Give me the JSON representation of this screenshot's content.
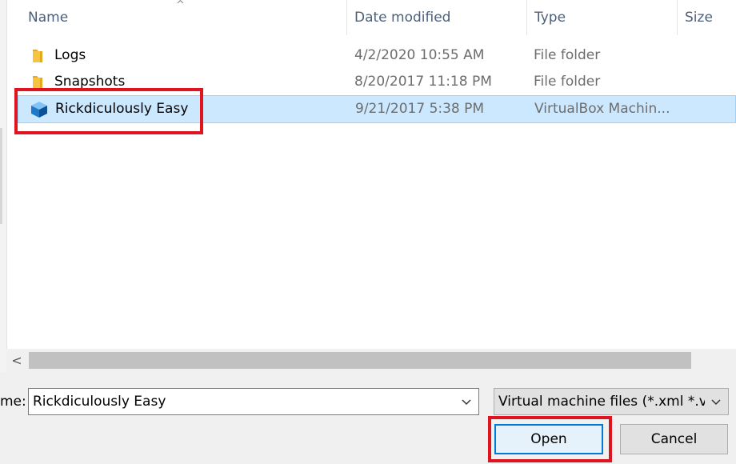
{
  "columns": {
    "name": "Name",
    "date": "Date modified",
    "type": "Type",
    "size": "Size"
  },
  "files": [
    {
      "icon": "folder-icon",
      "name": "Logs",
      "date": "4/2/2020 10:55 AM",
      "type": "File folder",
      "selected": false
    },
    {
      "icon": "folder-icon",
      "name": "Snapshots",
      "date": "8/20/2017 11:18 PM",
      "type": "File folder",
      "selected": false
    },
    {
      "icon": "virtualbox-machine-icon",
      "name": "Rickdiculously Easy",
      "date": "9/21/2017 5:38 PM",
      "type": "VirtualBox Machin...",
      "selected": true
    }
  ],
  "filename": {
    "label": "me:",
    "value": "Rickdiculously Easy"
  },
  "filter": {
    "value": "Virtual machine files (*.xml *.vbox)"
  },
  "buttons": {
    "open": "Open",
    "cancel": "Cancel"
  },
  "colors": {
    "selection": "#cce8ff",
    "highlight": "#e0141e",
    "folder": "#f6c443",
    "accent": "#0078d7"
  }
}
